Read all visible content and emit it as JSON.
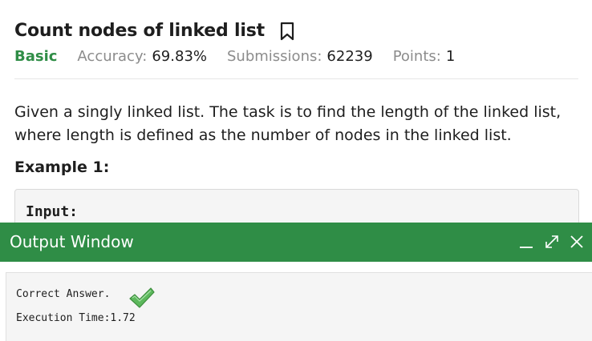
{
  "problem": {
    "title": "Count nodes of linked list",
    "difficulty": "Basic",
    "accuracy_label": "Accuracy:",
    "accuracy_value": "69.83%",
    "submissions_label": "Submissions:",
    "submissions_value": "62239",
    "points_label": "Points:",
    "points_value": "1",
    "description": "Given a singly linked list. The task is to find the length of the linked list, where length is defined as the number of nodes in the linked list.",
    "example_heading": "Example 1:",
    "example_input_label": "Input:"
  },
  "output_window": {
    "title": "Output Window",
    "result_line": "Correct Answer.",
    "execution_line": "Execution Time:1.72"
  },
  "colors": {
    "accent_green": "#2f8d46",
    "check_green": "#5cb85c"
  },
  "icons": [
    "bookmark-icon",
    "minimize-icon",
    "maximize-icon",
    "close-icon",
    "checkmark-icon"
  ]
}
